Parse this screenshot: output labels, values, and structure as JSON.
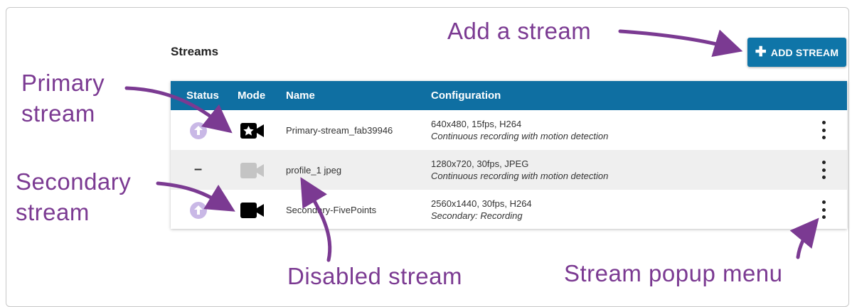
{
  "panel": {
    "title": "Streams",
    "add_button_label": "ADD STREAM"
  },
  "table": {
    "columns": [
      "Status",
      "Mode",
      "Name",
      "Configuration"
    ],
    "rows": [
      {
        "name": "Primary-stream_fab39946",
        "config_line1": "640x480, 15fps, H264",
        "config_line2": "Continuous recording with motion detection",
        "status": "primary",
        "mode": "primary-camera"
      },
      {
        "name": "profile_1 jpeg",
        "config_line1": "1280x720, 30fps, JPEG",
        "config_line2": "Continuous recording with motion detection",
        "status": "disabled",
        "status_text": "–",
        "mode": "disabled-camera"
      },
      {
        "name": "Secondary-FivePoints",
        "config_line1": "2560x1440, 30fps, H264",
        "config_line2": "Secondary: Recording",
        "status": "secondary",
        "mode": "camera"
      }
    ]
  },
  "annotations": {
    "add_stream": "Add a stream",
    "primary_stream_line1": "Primary",
    "primary_stream_line2": "stream",
    "secondary_stream_line1": "Secondary",
    "secondary_stream_line2": "stream",
    "disabled_stream": "Disabled stream",
    "popup_menu": "Stream popup menu"
  },
  "colors": {
    "header_blue": "#0f6fa2",
    "button_blue": "#0f75a8",
    "annotation_purple": "#7b3a92",
    "upload_icon": "#c9b8e6"
  }
}
